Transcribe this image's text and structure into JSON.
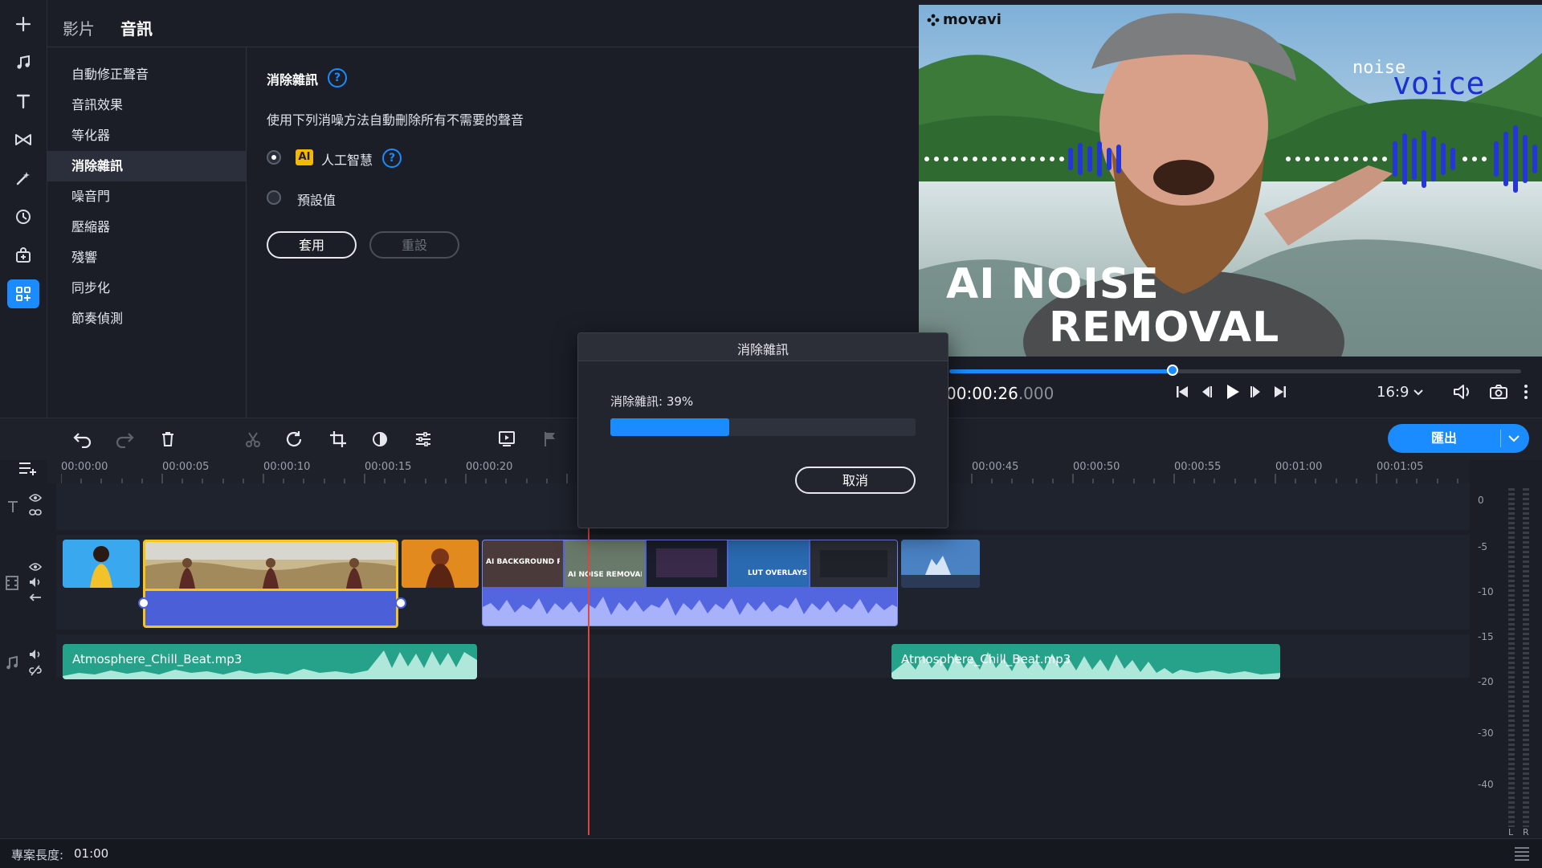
{
  "tabs": [
    "影片",
    "音訊"
  ],
  "categories": [
    "自動修正聲音",
    "音訊效果",
    "等化器",
    "消除雜訊",
    "噪音門",
    "壓縮器",
    "殘響",
    "同步化",
    "節奏偵測"
  ],
  "settings": {
    "title": "消除雜訊",
    "description": "使用下列消噪方法自動刪除所有不需要的聲音",
    "option_ai_badge": "AI",
    "option_ai": "人工智慧",
    "option_preset": "預設值",
    "apply": "套用",
    "reset": "重設",
    "help": "?"
  },
  "preview": {
    "brand": "movavi",
    "noise_text": "noise",
    "voice_text": "voice",
    "headline_1": "AI NOISE",
    "headline_2": "REMOVAL",
    "timecode_main": "00:00:26",
    "timecode_ms": ".000",
    "progress": 0.39,
    "aspect": "16:9"
  },
  "toolbar": {
    "export": "匯出"
  },
  "ruler": [
    "00:00:00",
    "00:00:05",
    "00:00:10",
    "00:00:15",
    "00:00:20",
    "00:00:45",
    "00:00:50",
    "00:00:55",
    "00:01:00",
    "00:01:05"
  ],
  "timeline": {
    "audio_clip_1": "Atmosphere_Chill_Beat.mp3",
    "audio_clip_2": "Atmosphere_Chill_Beat.mp3",
    "thumb_texts": [
      "AI BACKGROUND REMOVAL",
      "AI NOISE REMOVAL",
      "LUT OVERLAYS"
    ]
  },
  "meter": [
    "0",
    "-5",
    "-10",
    "-15",
    "-20",
    "-30",
    "-40"
  ],
  "meter_lr": [
    "L",
    "R"
  ],
  "status": {
    "label": "專案長度:",
    "value": "01:00"
  },
  "dialog": {
    "title": "消除雜訊",
    "progress_text": "消除雜訊: 39%",
    "progress": 0.39,
    "cancel": "取消"
  },
  "colors": {
    "accent": "#1a8cff",
    "ai_badge": "#f5b800",
    "audio_clip": "#26a18a",
    "selected": "#f5c518",
    "playhead": "#e0453a"
  }
}
